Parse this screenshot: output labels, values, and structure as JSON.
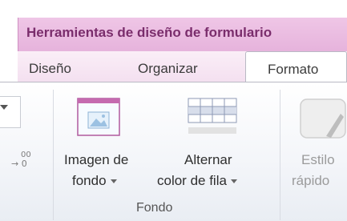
{
  "contextual": {
    "title": "Herramientas de diseño de formulario"
  },
  "tabs": [
    {
      "label": "Diseño"
    },
    {
      "label": "Organizar"
    },
    {
      "label": "Formato"
    }
  ],
  "previous_group": {
    "decimal_top": "00",
    "decimal_bottom": "→ 0"
  },
  "fondo_group": {
    "label": "Fondo",
    "background_image": {
      "line1": "Imagen de",
      "line2": "fondo"
    },
    "alternate_row_color": {
      "line1": "Alternar",
      "line2": "color de fila"
    }
  },
  "quick_styles": {
    "line1": "Estilo",
    "line2": "rápido"
  },
  "colors": {
    "contextual_accent": "#e6b3dc",
    "contextual_text": "#7a2d6c"
  },
  "icons": [
    "image-background-icon",
    "alternate-row-color-icon",
    "quick-styles-icon",
    "decimal-icon",
    "dropdown-arrow-icon"
  ]
}
